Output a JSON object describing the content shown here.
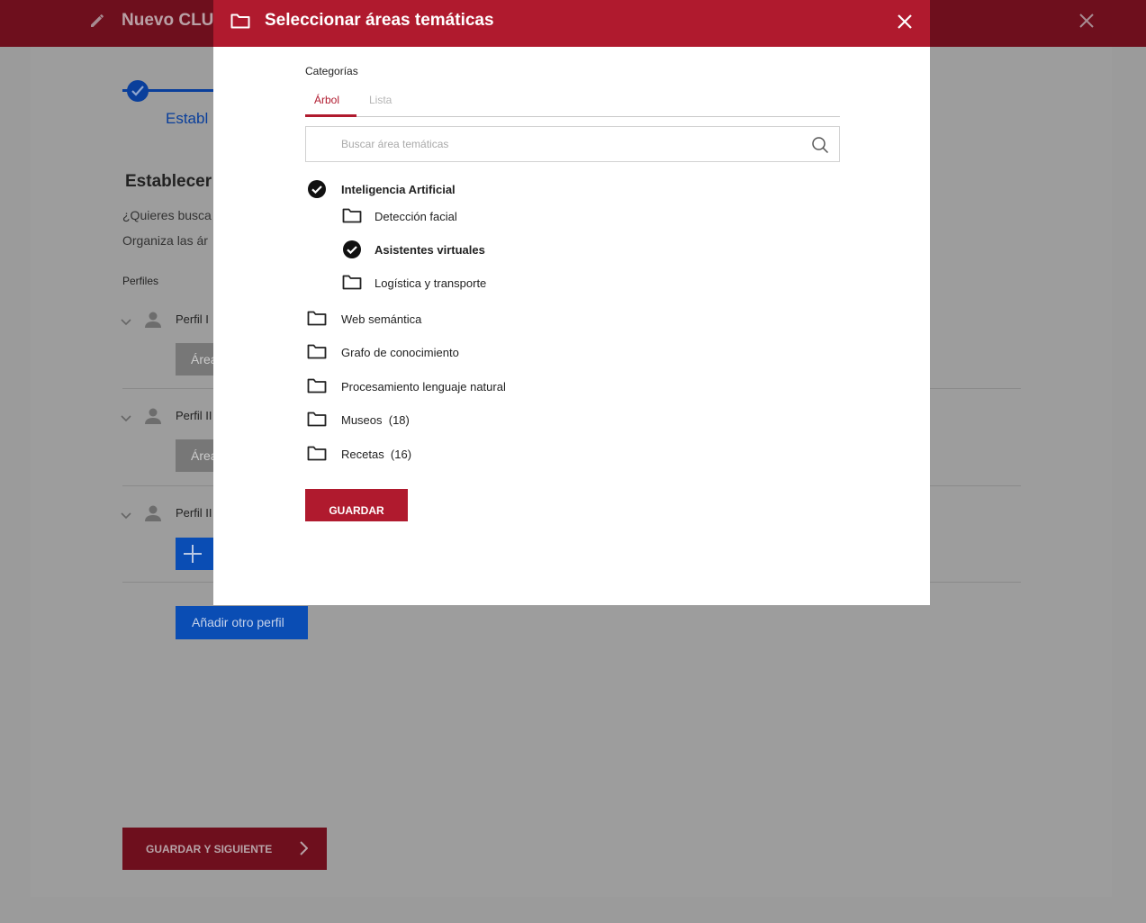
{
  "background": {
    "header": {
      "title": "Nuevo CLU"
    },
    "stepper": {
      "label": "Establ"
    },
    "section_title": "Establecer",
    "intro_lines": [
      "¿Quieres busca",
      "Organiza las ár"
    ],
    "profiles_label": "Perfiles",
    "profiles": [
      {
        "name": "Perfil I",
        "area_button": "Área"
      },
      {
        "name": "Perfil II",
        "area_button": "Área"
      },
      {
        "name": "Perfil II"
      }
    ],
    "add_profile_label": "Añadir otro perfil",
    "save_next_label": "GUARDAR Y SIGUIENTE"
  },
  "modal": {
    "title": "Seleccionar áreas temáticas",
    "categories_label": "Categorías",
    "tabs": [
      {
        "label": "Árbol",
        "active": true
      },
      {
        "label": "Lista",
        "active": false
      }
    ],
    "search_placeholder": "Buscar área temáticas",
    "tree": [
      {
        "label": "Inteligencia Artificial",
        "checked": true,
        "level": 0
      },
      {
        "label": "Detección facial",
        "checked": false,
        "level": 1
      },
      {
        "label": "Asistentes virtuales",
        "checked": true,
        "level": 1
      },
      {
        "label": "Logística y transporte",
        "checked": false,
        "level": 1
      },
      {
        "label": "Web semántica",
        "checked": false,
        "level": 0
      },
      {
        "label": "Grafo de conocimiento",
        "checked": false,
        "level": 0
      },
      {
        "label": "Procesamiento lenguaje natural",
        "checked": false,
        "level": 0
      },
      {
        "label": "Museos  (18)",
        "checked": false,
        "level": 0
      },
      {
        "label": "Recetas  (16)",
        "checked": false,
        "level": 0
      }
    ],
    "save_label": "GUARDAR"
  },
  "colors": {
    "modal_header": "#b01a2e",
    "background_header": "#6e0f1d",
    "primary_blue": "#0a4db4",
    "overlay": "#9b9b9b"
  }
}
